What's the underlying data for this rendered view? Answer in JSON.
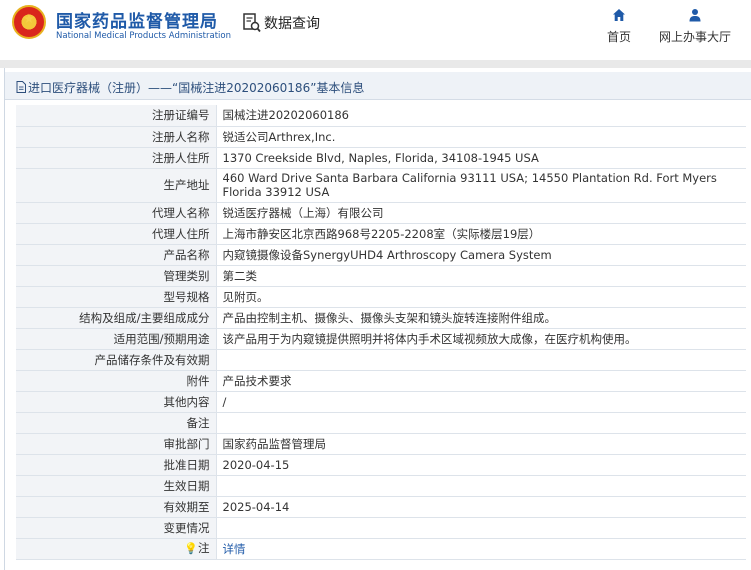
{
  "header": {
    "org_cn": "国家药品监督管理局",
    "org_en": "National Medical Products Administration",
    "search_title": "数据查询",
    "nav": [
      {
        "label": "首页",
        "icon": "home-icon"
      },
      {
        "label": "网上办事大厅",
        "icon": "user-icon"
      }
    ]
  },
  "breadcrumb": "进口医疗器械（注册）——“国械注进20202060186”基本信息",
  "rows": [
    {
      "key": "注册证编号",
      "value": "国械注进20202060186"
    },
    {
      "key": "注册人名称",
      "value": "锐适公司Arthrex,Inc."
    },
    {
      "key": "注册人住所",
      "value": "1370 Creekside Blvd, Naples, Florida, 34108-1945 USA"
    },
    {
      "key": "生产地址",
      "value": "460 Ward Drive Santa Barbara California 93111 USA; 14550 Plantation Rd. Fort Myers Florida 33912 USA"
    },
    {
      "key": "代理人名称",
      "value": "锐适医疗器械（上海）有限公司"
    },
    {
      "key": "代理人住所",
      "value": "上海市静安区北京西路968号2205-2208室（实际楼层19层）"
    },
    {
      "key": "产品名称",
      "value": "内窥镜摄像设备SynergyUHD4 Arthroscopy Camera System"
    },
    {
      "key": "管理类别",
      "value": "第二类"
    },
    {
      "key": "型号规格",
      "value": "见附页。"
    },
    {
      "key": "结构及组成/主要组成成分",
      "value": "产品由控制主机、摄像头、摄像头支架和镜头旋转连接附件组成。"
    },
    {
      "key": "适用范围/预期用途",
      "value": "该产品用于为内窥镜提供照明并将体内手术区域视频放大成像，在医疗机构使用。"
    },
    {
      "key": "产品储存条件及有效期",
      "value": ""
    },
    {
      "key": "附件",
      "value": "产品技术要求"
    },
    {
      "key": "其他内容",
      "value": "/"
    },
    {
      "key": "备注",
      "value": ""
    },
    {
      "key": "审批部门",
      "value": "国家药品监督管理局"
    },
    {
      "key": "批准日期",
      "value": "2020-04-15"
    },
    {
      "key": "生效日期",
      "value": ""
    },
    {
      "key": "有效期至",
      "value": "2025-04-14"
    },
    {
      "key": "变更情况",
      "value": ""
    }
  ],
  "note_row": {
    "key": "注",
    "icon": "lightbulb-icon",
    "link": "详情"
  }
}
